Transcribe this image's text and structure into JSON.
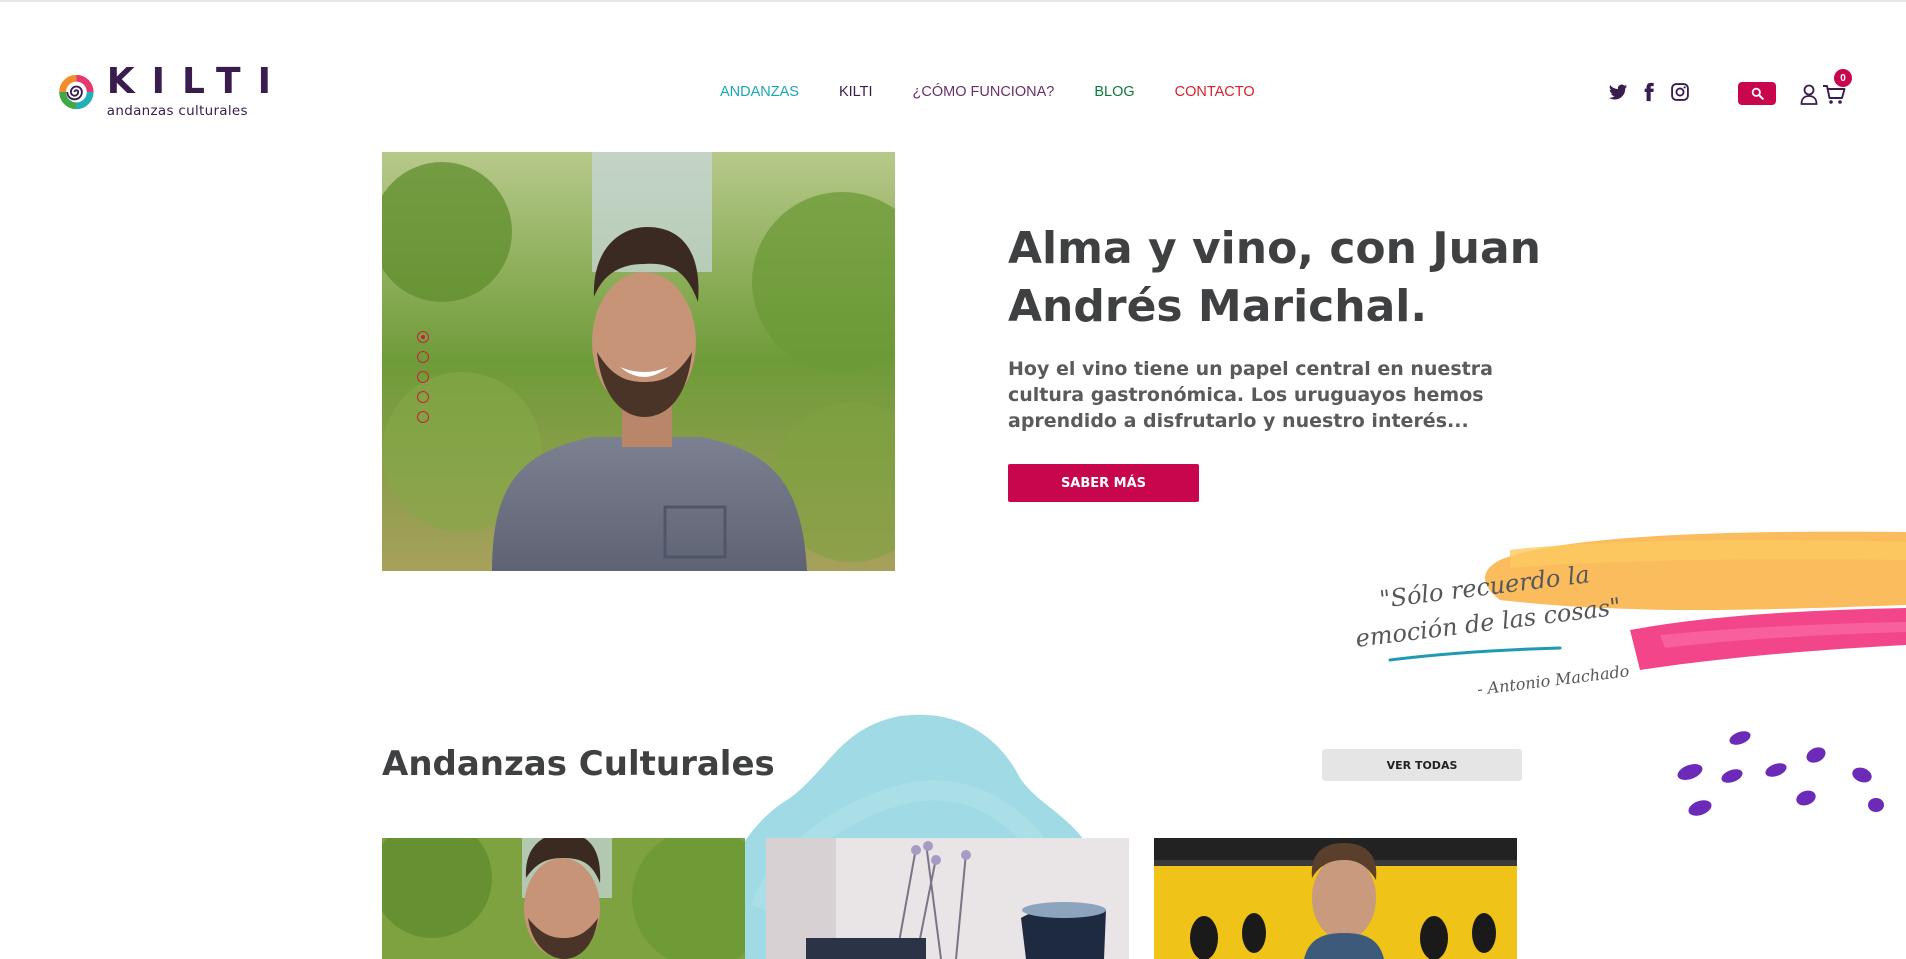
{
  "header": {
    "logo_word": "KILTI",
    "logo_tagline": "andanzas culturales",
    "nav": [
      {
        "label": "ANDANZAS",
        "color": "#1aa6b7"
      },
      {
        "label": "KILTI",
        "color": "#3a1d4f"
      },
      {
        "label": "¿CÓMO FUNCIONA?",
        "color": "#6a2f6b"
      },
      {
        "label": "BLOG",
        "color": "#0f7a3e"
      },
      {
        "label": "CONTACTO",
        "color": "#d81f2d"
      }
    ],
    "social_icons": [
      "twitter-icon",
      "facebook-icon",
      "instagram-icon"
    ],
    "cart_count": "0"
  },
  "hero": {
    "title": "Alma y vino, con Juan Andrés Marichal.",
    "excerpt": "Hoy el vino tiene un papel central en nuestra cultura gastronómica. Los uruguayos hemos aprendido a disfrutarlo y nuestro interés...",
    "button_label": "SABER MÁS",
    "slides_count": 5,
    "active_slide": 1
  },
  "quote": {
    "line1": "\"Sólo recuerdo la",
    "line2": "emoción de las cosas\"",
    "author": "- Antonio Machado"
  },
  "section": {
    "title": "Andanzas Culturales",
    "button_label": "VER TODAS"
  },
  "colors": {
    "accent": "#c8064d",
    "heading": "#3f4041",
    "brand_purple": "#3a1d4f"
  }
}
